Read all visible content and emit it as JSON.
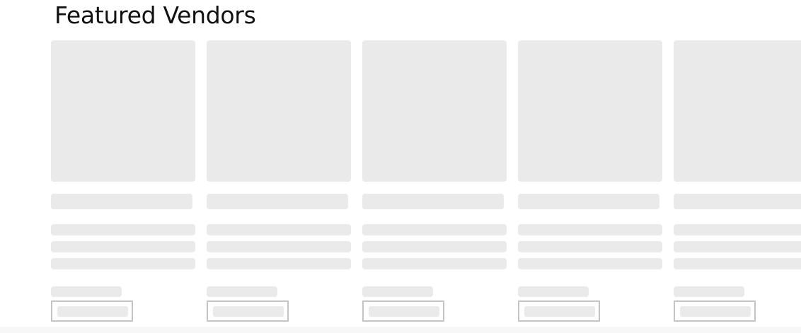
{
  "section": {
    "title": "Featured Vendors"
  },
  "vendor_cards": [
    {
      "state": "loading"
    },
    {
      "state": "loading"
    },
    {
      "state": "loading"
    },
    {
      "state": "loading"
    },
    {
      "state": "loading"
    }
  ],
  "colors": {
    "skeleton": "#eaeaea",
    "button_border": "#c4c4c4",
    "title_text": "#111111",
    "footer_strip": "#f7f7f7"
  }
}
